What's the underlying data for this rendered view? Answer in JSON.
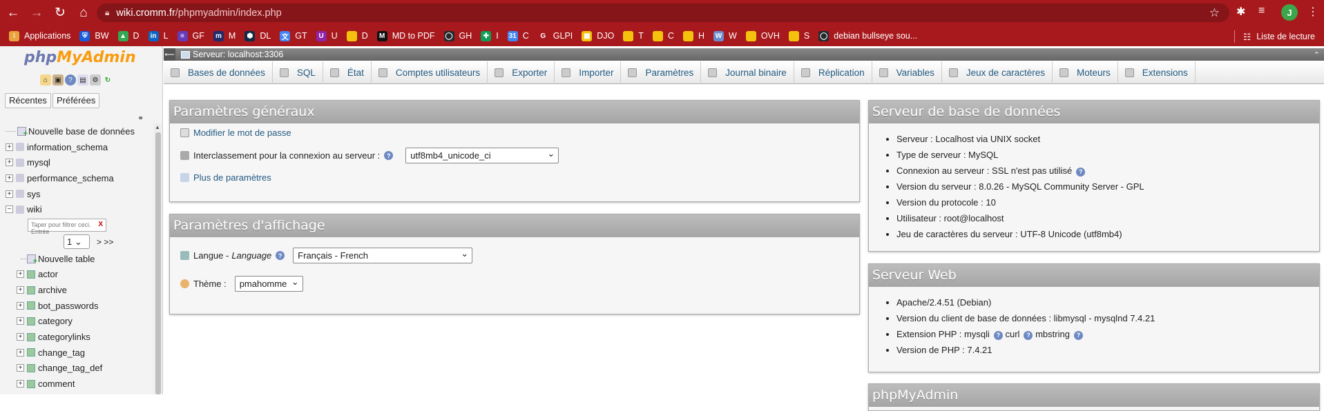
{
  "browser": {
    "url_host": "wiki.cromm.fr",
    "url_path": "/phpmyadmin/index.php",
    "profile_initial": "J",
    "bookmarks": [
      {
        "label": "Applications",
        "color": "#e8a33d",
        "glyph": "⁝"
      },
      {
        "label": "BW",
        "color": "#175ddc",
        "glyph": "⛨"
      },
      {
        "label": "D",
        "color": "#34a853",
        "glyph": "▲"
      },
      {
        "label": "L",
        "color": "#0a66c2",
        "glyph": "in"
      },
      {
        "label": "GF",
        "color": "#673ab7",
        "glyph": "≡"
      },
      {
        "label": "M",
        "color": "#1f2b6b",
        "glyph": "m"
      },
      {
        "label": "DL",
        "color": "#0f2b46",
        "glyph": "⬢"
      },
      {
        "label": "GT",
        "color": "#4285f4",
        "glyph": "文"
      },
      {
        "label": "U",
        "color": "#8e24aa",
        "glyph": "U"
      },
      {
        "label": "D",
        "color": "#f4c20d",
        "glyph": ""
      },
      {
        "label": "MD to PDF",
        "color": "#111111",
        "glyph": "M"
      },
      {
        "label": "GH",
        "color": "#24292e",
        "glyph": "◯"
      },
      {
        "label": "I",
        "color": "#0f9d58",
        "glyph": "✚"
      },
      {
        "label": "C",
        "color": "#4285f4",
        "glyph": "31"
      },
      {
        "label": "GLPI",
        "color": "#a8191d",
        "glyph": "G"
      },
      {
        "label": "DJO",
        "color": "#f4c20d",
        "glyph": "▦"
      },
      {
        "label": "T",
        "color": "#f4c20d",
        "glyph": ""
      },
      {
        "label": "C",
        "color": "#f4c20d",
        "glyph": ""
      },
      {
        "label": "H",
        "color": "#f4c20d",
        "glyph": ""
      },
      {
        "label": "W",
        "color": "#6b8cce",
        "glyph": "W"
      },
      {
        "label": "OVH",
        "color": "#f4c20d",
        "glyph": ""
      },
      {
        "label": "S",
        "color": "#f4c20d",
        "glyph": ""
      },
      {
        "label": "debian bullseye sou...",
        "color": "#24292e",
        "glyph": "◯"
      }
    ],
    "reading_list": "Liste de lecture"
  },
  "navigation": {
    "logo_php": "php",
    "logo_my": "MyAdmin",
    "tab_recent": "Récentes",
    "tab_favorites": "Préférées",
    "new_database": "Nouvelle base de données",
    "databases": [
      "information_schema",
      "mysql",
      "performance_schema",
      "sys",
      "wiki"
    ],
    "filter_placeholder": "Taper pour filtrer ceci. Entrée",
    "filter_clear": "X",
    "page_select": "1",
    "page_next": "> >>",
    "new_table": "Nouvelle table",
    "tables": [
      "actor",
      "archive",
      "bot_passwords",
      "category",
      "categorylinks",
      "change_tag",
      "change_tag_def",
      "comment"
    ]
  },
  "server_bar": {
    "label": "Serveur: localhost:3306"
  },
  "menu": {
    "tabs": [
      {
        "label": "Bases de données",
        "icon": "database-icon"
      },
      {
        "label": "SQL",
        "icon": "sql-icon"
      },
      {
        "label": "État",
        "icon": "status-icon"
      },
      {
        "label": "Comptes utilisateurs",
        "icon": "users-icon"
      },
      {
        "label": "Exporter",
        "icon": "export-icon"
      },
      {
        "label": "Importer",
        "icon": "import-icon"
      },
      {
        "label": "Paramètres",
        "icon": "wrench-icon"
      },
      {
        "label": "Journal binaire",
        "icon": "binlog-icon"
      },
      {
        "label": "Réplication",
        "icon": "replication-icon"
      },
      {
        "label": "Variables",
        "icon": "variables-icon"
      },
      {
        "label": "Jeux de caractères",
        "icon": "charset-icon"
      },
      {
        "label": "Moteurs",
        "icon": "engines-icon"
      },
      {
        "label": "Extensions",
        "icon": "plugins-icon"
      }
    ]
  },
  "general_settings": {
    "title": "Paramètres généraux",
    "change_password": "Modifier le mot de passe",
    "collation_label": "Interclassement pour la connexion au serveur :",
    "collation_value": "utf8mb4_unicode_ci",
    "more_settings": "Plus de paramètres"
  },
  "display_settings": {
    "title": "Paramètres d'affichage",
    "language_label": "Langue - ",
    "language_label_en": "Language",
    "language_value": "Français - French",
    "theme_label": "Thème :",
    "theme_value": "pmahomme"
  },
  "db_server": {
    "title": "Serveur de base de données",
    "items": [
      "Serveur : Localhost via UNIX socket",
      "Type de serveur : MySQL",
      "Connexion au serveur : SSL n'est pas utilisé",
      "Version du serveur : 8.0.26 - MySQL Community Server - GPL",
      "Version du protocole : 10",
      "Utilisateur : root@localhost",
      "Jeu de caractères du serveur : UTF-8 Unicode (utf8mb4)"
    ]
  },
  "web_server": {
    "title": "Serveur Web",
    "apache": "Apache/2.4.51 (Debian)",
    "client_version": "Version du client de base de données : libmysql - mysqlnd 7.4.21",
    "php_ext_label": "Extension PHP : mysqli",
    "php_ext_curl": "curl",
    "php_ext_mbstring": "mbstring",
    "php_version": "Version de PHP : 7.4.21"
  },
  "pma_panel": {
    "title": "phpMyAdmin"
  }
}
